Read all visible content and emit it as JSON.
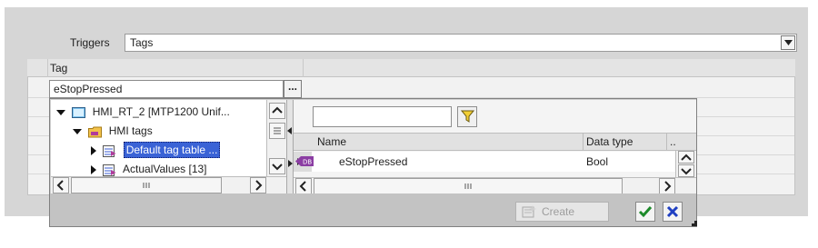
{
  "triggers": {
    "label": "Triggers",
    "value": "Tags"
  },
  "tag_table": {
    "column_header": "Tag",
    "input_value": "eStopPressed",
    "browse_label": "..."
  },
  "tree": {
    "items": [
      {
        "label": "HMI_RT_2 [MTP1200 Unif...",
        "expanded": true
      },
      {
        "label": "HMI tags",
        "expanded": true
      },
      {
        "label": "Default tag table ...",
        "selected": true
      },
      {
        "label": "ActualValues [13]"
      }
    ]
  },
  "list": {
    "filter_value": "",
    "columns": [
      "Name",
      "Data type",
      ".."
    ],
    "rows": [
      {
        "name": "eStopPressed",
        "data_type": "Bool"
      }
    ]
  },
  "footer": {
    "create_label": "Create"
  },
  "icons": {
    "filter": "funnel-icon",
    "tag": "tag-icon",
    "ok": "checkmark-icon",
    "cancel": "x-icon",
    "create": "create-tag-icon"
  },
  "colors": {
    "selection": "#3a63d6",
    "ok_green": "#1c8a2a",
    "cancel_blue": "#1f3fc2"
  }
}
